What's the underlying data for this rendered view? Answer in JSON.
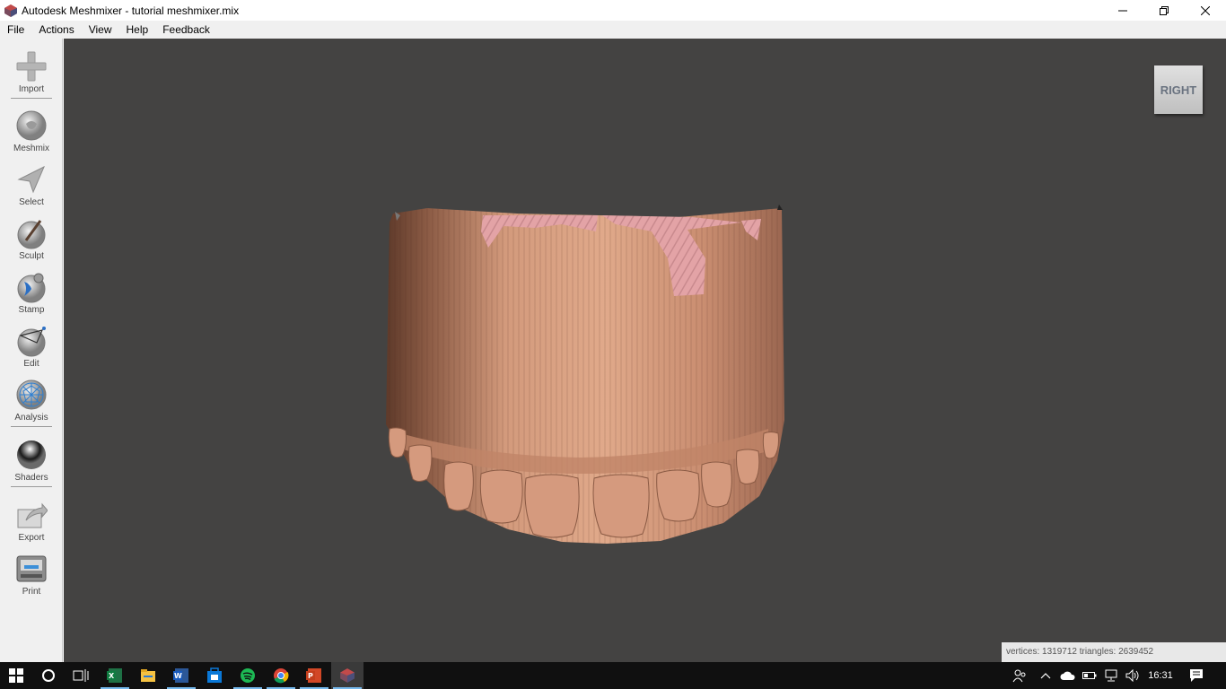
{
  "window": {
    "title": "Autodesk Meshmixer - tutorial meshmixer.mix",
    "minimize_icon": "minimize-icon",
    "maximize_icon": "restore-icon",
    "close_icon": "close-icon"
  },
  "menu": [
    {
      "label": "File"
    },
    {
      "label": "Actions"
    },
    {
      "label": "View"
    },
    {
      "label": "Help"
    },
    {
      "label": "Feedback"
    }
  ],
  "toolbar": {
    "import": "Import",
    "meshmix": "Meshmix",
    "select": "Select",
    "sculpt": "Sculpt",
    "stamp": "Stamp",
    "edit": "Edit",
    "analysis": "Analysis",
    "shaders": "Shaders",
    "export": "Export",
    "print": "Print"
  },
  "viewport": {
    "viewcube_face": "RIGHT",
    "status": "vertices: 1319712 triangles: 2639452",
    "background": "#444342",
    "model_color": "#d9a184",
    "gum_color": "#e6a3a6"
  },
  "taskbar": {
    "time": "16:31",
    "apps": [
      "windows-start-icon",
      "cortana-icon",
      "task-view-icon",
      "excel-icon",
      "file-explorer-icon",
      "word-icon",
      "store-icon",
      "spotify-icon",
      "chrome-icon",
      "powerpoint-icon",
      "meshmixer-icon"
    ]
  }
}
